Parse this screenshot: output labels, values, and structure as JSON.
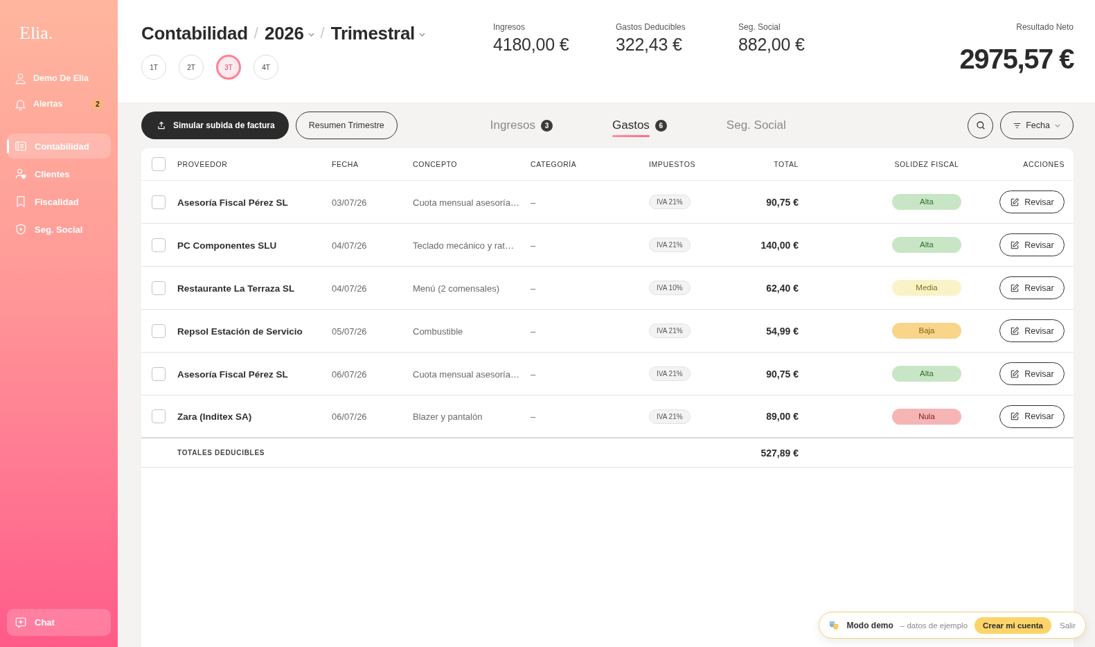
{
  "sidebar": {
    "logo": "Elia.",
    "account_items": [
      {
        "label": "Demo De Elia"
      },
      {
        "label": "Alertas",
        "badge": "2"
      }
    ],
    "nav_items": [
      {
        "label": "Contabilidad",
        "selected": true
      },
      {
        "label": "Clientes",
        "selected": false
      },
      {
        "label": "Fiscalidad",
        "selected": false
      },
      {
        "label": "Seg. Social",
        "selected": false
      }
    ],
    "chat_button": "Chat"
  },
  "header": {
    "breadcrumb": [
      {
        "label": "Contabilidad",
        "dropdown": false
      },
      {
        "separator": "/",
        "label": "2026",
        "dropdown": true
      },
      {
        "separator": "/",
        "label": "Trimestral",
        "dropdown": true
      }
    ],
    "quarters": [
      {
        "label": "1T",
        "selected": false
      },
      {
        "label": "2T",
        "selected": false
      },
      {
        "label": "3T",
        "selected": true
      },
      {
        "label": "4T",
        "selected": false
      }
    ],
    "stats": [
      {
        "label": "Ingresos",
        "value": "4180,00 €"
      },
      {
        "label": "Gastos Deducibles",
        "value": "322,43 €"
      },
      {
        "label": "Seg. Social",
        "value": "882,00 €"
      }
    ],
    "net_result": {
      "label": "Resultado Neto",
      "value": "2975,57 €"
    }
  },
  "toolbar": {
    "upload_button": "Simular subida de factura",
    "summary_button": "Resumen Trimestre",
    "tabs": [
      {
        "label": "Ingresos",
        "count": "3",
        "selected": false
      },
      {
        "label": "Gastos",
        "count": "6",
        "selected": true
      },
      {
        "label": "Seg. Social",
        "selected": false
      }
    ],
    "sort_button": "Fecha"
  },
  "table": {
    "select_all": {
      "checked": false
    },
    "columns": [
      "PROVEEDOR",
      "FECHA",
      "CONCEPTO",
      "CATEGORÍA",
      "IMPUESTOS",
      "TOTAL",
      "SOLIDEZ FISCAL",
      "ACCIONES"
    ],
    "rows": [
      {
        "checked": false,
        "provider": "Asesoría Fiscal Pérez SL",
        "date": "03/07/26",
        "concept": "Cuota mensual asesoría…",
        "category": "–",
        "tax": "IVA 21%",
        "total": "90,75 €",
        "solidity": {
          "label": "Alta",
          "color": "#c8e6c5"
        },
        "action": "Revisar"
      },
      {
        "checked": false,
        "provider": "PC Componentes SLU",
        "date": "04/07/26",
        "concept": "Teclado mecánico y rat…",
        "category": "–",
        "tax": "IVA 21%",
        "total": "140,00 €",
        "solidity": {
          "label": "Alta",
          "color": "#c8e6c5"
        },
        "action": "Revisar"
      },
      {
        "checked": false,
        "provider": "Restaurante La Terraza SL",
        "date": "04/07/26",
        "concept": "Menú (2 comensales)",
        "category": "–",
        "tax": "IVA 10%",
        "total": "62,40 €",
        "solidity": {
          "label": "Media",
          "color": "#faf3c8"
        },
        "action": "Revisar"
      },
      {
        "checked": false,
        "provider": "Repsol Estación de Servicio",
        "date": "05/07/26",
        "concept": "Combustible",
        "category": "–",
        "tax": "IVA 21%",
        "total": "54,99 €",
        "solidity": {
          "label": "Baja",
          "color": "#f9d58a"
        },
        "action": "Revisar"
      },
      {
        "checked": false,
        "provider": "Asesoría Fiscal Pérez SL",
        "date": "06/07/26",
        "concept": "Cuota mensual asesoría…",
        "category": "–",
        "tax": "IVA 21%",
        "total": "90,75 €",
        "solidity": {
          "label": "Alta",
          "color": "#c8e6c5"
        },
        "action": "Revisar"
      },
      {
        "checked": false,
        "provider": "Zara (Inditex SA)",
        "date": "06/07/26",
        "concept": "Blazer y pantalón",
        "category": "–",
        "tax": "IVA 21%",
        "total": "89,00 €",
        "solidity": {
          "label": "Nula",
          "color": "#f6b5b5"
        },
        "action": "Revisar"
      }
    ],
    "totals": {
      "label": "TOTALES DEDUCIBLES",
      "total": "527,89 €"
    }
  },
  "demo_banner": {
    "title": "Modo demo",
    "note": "– datos de ejemplo",
    "create_button": "Crear mi cuenta",
    "exit_link": "Salir"
  }
}
